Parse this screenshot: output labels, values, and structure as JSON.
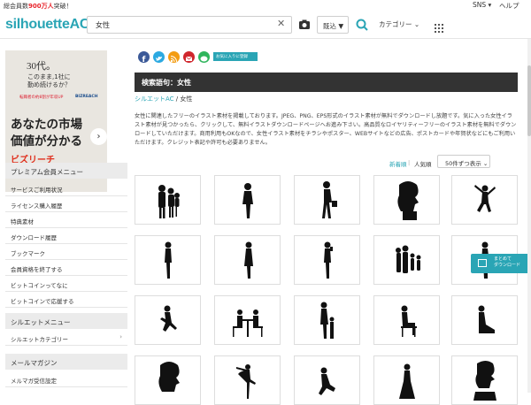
{
  "topbar": {
    "promo_prefix": "総会員数",
    "promo_count": "900万人",
    "promo_suffix": "突破！",
    "sns": "SNS ▾",
    "help": "ヘルプ"
  },
  "header": {
    "logo_main": "silhouette",
    "logo_ac": "AC",
    "search_value": "女性",
    "clear": "✕",
    "sort_label": "既込 ▼",
    "category_label": "カテゴリー ⌄"
  },
  "ad": {
    "line1": "30代。",
    "line2a": "このまま,1社に",
    "line2b": "勤め続けるか？",
    "small_red": "転職者の約8割が年収UP",
    "small_brand": "BIZREACH",
    "headline1": "あなたの市場",
    "headline2": "価値が分かる",
    "brand": "ビズリーチ",
    "arrow": "›"
  },
  "sidebar": {
    "premium_title": "プレミアム会員メニュー",
    "premium_items": [
      "サービスご利用状況",
      "ライセンス購入履歴",
      "特典素材",
      "ダウンロード履歴",
      "ブックマーク",
      "会員資格を終了する",
      "ビットコインってなに",
      "ビットコインで応援する"
    ],
    "silhouette_title": "シルエットメニュー",
    "silhouette_items": [
      "シルエットカテゴリー"
    ],
    "silhouette_chev": "›",
    "mail_title": "メールマガジン",
    "mail_items": [
      "メルマガ受信設定"
    ]
  },
  "share": {
    "favorite": "お気に入りに登録"
  },
  "keyword": {
    "label": "検索語句：女性"
  },
  "breadcrumb": {
    "home": "シルエットAC",
    "sep": "/",
    "current": "女性"
  },
  "description": "女性に関連したフリーのイラスト素材を掲載しております。JPEG、PNG、EPS形式のイラスト素材が無料でダウンロードし放題です。気に入った女性イラスト素材が見つかったら、クリックして、無料イラストダウンロードページへお進み下さい。高品質なロイヤリティーフリーのイラスト素材を無料でダウンロードしていただけます。商用利用もOKなので、女性イラスト素材をチラシやポスター、WEBサイトなどの広告、ポストカードや年賀状などにもご利用いただけます。クレジット表記や許可も必要ありません。",
  "sorting": {
    "newest": "新着順",
    "sep": "|",
    "popular": "人気順",
    "per_page": "50件ずつ表示 ⌄"
  },
  "floating": {
    "line1": "まとめて",
    "line2": "ダウンロード"
  },
  "tiles": [
    {
      "name": "tile-family-group"
    },
    {
      "name": "tile-woman-standing"
    },
    {
      "name": "tile-woman-walking-bag"
    },
    {
      "name": "tile-woman-profile-hair"
    },
    {
      "name": "tile-woman-jumping"
    },
    {
      "name": "tile-woman-posing"
    },
    {
      "name": "tile-woman-dress"
    },
    {
      "name": "tile-woman-phone"
    },
    {
      "name": "tile-family-four"
    },
    {
      "name": "tile-woman-side"
    },
    {
      "name": "tile-woman-running"
    },
    {
      "name": "tile-women-table"
    },
    {
      "name": "tile-mother-child"
    },
    {
      "name": "tile-woman-sitting-chair"
    },
    {
      "name": "tile-woman-sitting-floor"
    },
    {
      "name": "tile-woman-bust-round"
    },
    {
      "name": "tile-ballet-dancer"
    },
    {
      "name": "tile-woman-crouching"
    },
    {
      "name": "tile-woman-gown"
    },
    {
      "name": "tile-woman-bust"
    }
  ]
}
